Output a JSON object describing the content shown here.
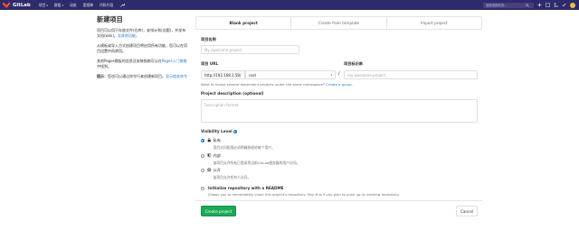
{
  "header": {
    "brand": "GitLab",
    "nav": [
      {
        "label": "项目",
        "caret": true
      },
      {
        "label": "群组",
        "caret": true
      },
      {
        "label": "动态",
        "caret": false
      },
      {
        "label": "里程碑",
        "caret": false
      },
      {
        "label": "代码片段",
        "caret": false
      }
    ],
    "search_placeholder": "搜索或跳转到..."
  },
  "sidebar": {
    "title": "新建项目",
    "intro_text": "项目可以用于存放文件(仓库)，安排计划(议题)，并发布文档(wiki)。",
    "intro_link": "及其他功能。",
    "template_text": "从模板或导入方式创建项目将启用所有功能，您可以在项目设置中再禁用。",
    "pages_text_before": "其他Pages模板的信息及安装指南可以在",
    "pages_link": "Pages入门指南",
    "pages_text_after": "中找到。",
    "tip_label": "提示：",
    "tip_text": "您也可以通过命令行来创建新项目。",
    "tip_link": "显示相关命令"
  },
  "tabs": [
    "Blank project",
    "Create from template",
    "Import project"
  ],
  "form": {
    "name_label": "项目名称",
    "name_placeholder": "My awesome project",
    "url_label": "项目 URL",
    "url_prefix": "http://192.168.1.58/",
    "namespace": "root",
    "slug_label": "项目标识串",
    "slug_placeholder": "my-awesome-project",
    "help_text": "Want to house several dependent projects under the same namespace?",
    "help_link": "Create a group.",
    "description_label": "Project description (optional)",
    "description_placeholder": "Description format",
    "visibility_label": "Visibility Level",
    "visibility": [
      {
        "title": "私有",
        "desc": "项目访问权限必须明确授权给每个用户。",
        "icon": "lock-icon",
        "checked": true
      },
      {
        "title": "内部",
        "desc": "该项目允许所有已登录到当前GitLab服务器的用户访问。",
        "icon": "shield-icon",
        "checked": false
      },
      {
        "title": "公开",
        "desc": "该项目允许任何人访问。",
        "icon": "globe-icon",
        "checked": false
      }
    ],
    "readme_title": "Initialize repository with a README",
    "readme_desc": "Allows you to immediately clone this project's repository. Skip this if you plan to push up an existing repository.",
    "create_button": "Create project",
    "cancel_button": "Cancel"
  }
}
